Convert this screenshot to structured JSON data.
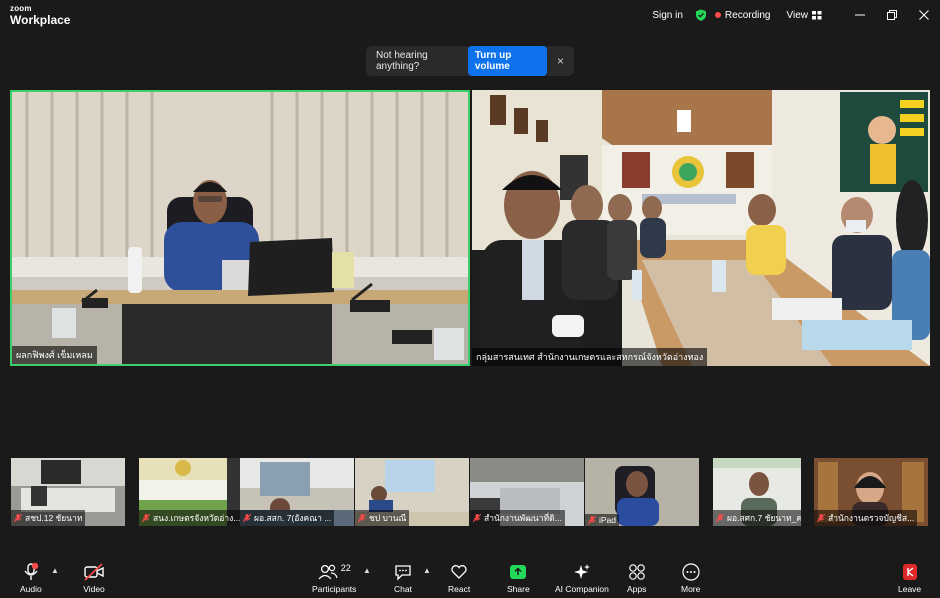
{
  "app": {
    "brand_top": "zoom",
    "brand_name": "Workplace"
  },
  "titlebar": {
    "sign_in": "Sign in",
    "recording": "Recording",
    "view": "View"
  },
  "notice": {
    "message": "Not hearing anything?",
    "button": "Turn up volume",
    "close": "×"
  },
  "main_videos": [
    {
      "name": "ผลกฟิพงศ์ เข็มเหลม"
    },
    {
      "name": "กลุ่มสารสนเทศ สำนักงานเกษตรและสหกรณ์จังหวัดอ่างทอง"
    }
  ],
  "gallery": [
    {
      "name": "สชป.12 ชัยนาท"
    },
    {
      "name": "สนง.เกษตรจังหวัดอ่าง..."
    },
    {
      "name": "ผอ.สสก. 7(อังคณา ..."
    },
    {
      "name": "ชป บานณี"
    },
    {
      "name": "สำนักงานพัฒนาที่ดิ..."
    },
    {
      "name": "iPad"
    },
    {
      "name": "ผอ.สศก.7 ชัยนาท_ค..."
    },
    {
      "name": "สำนักงานตรวจบัญชีส..."
    }
  ],
  "toolbar": {
    "audio": "Audio",
    "video": "Video",
    "participants": "Participants",
    "participants_count": "22",
    "chat": "Chat",
    "react": "React",
    "share": "Share",
    "ai_companion": "AI Companion",
    "apps": "Apps",
    "more": "More",
    "leave": "Leave"
  },
  "colors": {
    "accent_blue": "#0e72ed",
    "active_speaker": "#3ccf6b",
    "share_green": "#23d959",
    "mute_red": "#ff4a4a"
  }
}
